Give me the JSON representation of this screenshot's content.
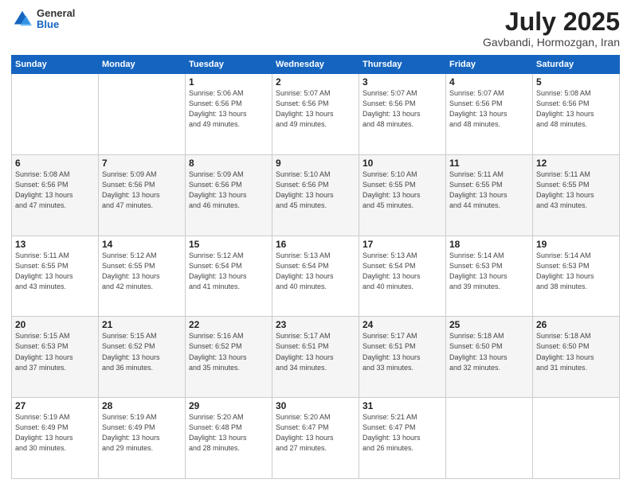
{
  "logo": {
    "general": "General",
    "blue": "Blue"
  },
  "header": {
    "month": "July 2025",
    "location": "Gavbandi, Hormozgan, Iran"
  },
  "weekdays": [
    "Sunday",
    "Monday",
    "Tuesday",
    "Wednesday",
    "Thursday",
    "Friday",
    "Saturday"
  ],
  "rows": [
    [
      {
        "day": "",
        "info": ""
      },
      {
        "day": "",
        "info": ""
      },
      {
        "day": "1",
        "info": "Sunrise: 5:06 AM\nSunset: 6:56 PM\nDaylight: 13 hours\nand 49 minutes."
      },
      {
        "day": "2",
        "info": "Sunrise: 5:07 AM\nSunset: 6:56 PM\nDaylight: 13 hours\nand 49 minutes."
      },
      {
        "day": "3",
        "info": "Sunrise: 5:07 AM\nSunset: 6:56 PM\nDaylight: 13 hours\nand 48 minutes."
      },
      {
        "day": "4",
        "info": "Sunrise: 5:07 AM\nSunset: 6:56 PM\nDaylight: 13 hours\nand 48 minutes."
      },
      {
        "day": "5",
        "info": "Sunrise: 5:08 AM\nSunset: 6:56 PM\nDaylight: 13 hours\nand 48 minutes."
      }
    ],
    [
      {
        "day": "6",
        "info": "Sunrise: 5:08 AM\nSunset: 6:56 PM\nDaylight: 13 hours\nand 47 minutes."
      },
      {
        "day": "7",
        "info": "Sunrise: 5:09 AM\nSunset: 6:56 PM\nDaylight: 13 hours\nand 47 minutes."
      },
      {
        "day": "8",
        "info": "Sunrise: 5:09 AM\nSunset: 6:56 PM\nDaylight: 13 hours\nand 46 minutes."
      },
      {
        "day": "9",
        "info": "Sunrise: 5:10 AM\nSunset: 6:56 PM\nDaylight: 13 hours\nand 45 minutes."
      },
      {
        "day": "10",
        "info": "Sunrise: 5:10 AM\nSunset: 6:55 PM\nDaylight: 13 hours\nand 45 minutes."
      },
      {
        "day": "11",
        "info": "Sunrise: 5:11 AM\nSunset: 6:55 PM\nDaylight: 13 hours\nand 44 minutes."
      },
      {
        "day": "12",
        "info": "Sunrise: 5:11 AM\nSunset: 6:55 PM\nDaylight: 13 hours\nand 43 minutes."
      }
    ],
    [
      {
        "day": "13",
        "info": "Sunrise: 5:11 AM\nSunset: 6:55 PM\nDaylight: 13 hours\nand 43 minutes."
      },
      {
        "day": "14",
        "info": "Sunrise: 5:12 AM\nSunset: 6:55 PM\nDaylight: 13 hours\nand 42 minutes."
      },
      {
        "day": "15",
        "info": "Sunrise: 5:12 AM\nSunset: 6:54 PM\nDaylight: 13 hours\nand 41 minutes."
      },
      {
        "day": "16",
        "info": "Sunrise: 5:13 AM\nSunset: 6:54 PM\nDaylight: 13 hours\nand 40 minutes."
      },
      {
        "day": "17",
        "info": "Sunrise: 5:13 AM\nSunset: 6:54 PM\nDaylight: 13 hours\nand 40 minutes."
      },
      {
        "day": "18",
        "info": "Sunrise: 5:14 AM\nSunset: 6:53 PM\nDaylight: 13 hours\nand 39 minutes."
      },
      {
        "day": "19",
        "info": "Sunrise: 5:14 AM\nSunset: 6:53 PM\nDaylight: 13 hours\nand 38 minutes."
      }
    ],
    [
      {
        "day": "20",
        "info": "Sunrise: 5:15 AM\nSunset: 6:53 PM\nDaylight: 13 hours\nand 37 minutes."
      },
      {
        "day": "21",
        "info": "Sunrise: 5:15 AM\nSunset: 6:52 PM\nDaylight: 13 hours\nand 36 minutes."
      },
      {
        "day": "22",
        "info": "Sunrise: 5:16 AM\nSunset: 6:52 PM\nDaylight: 13 hours\nand 35 minutes."
      },
      {
        "day": "23",
        "info": "Sunrise: 5:17 AM\nSunset: 6:51 PM\nDaylight: 13 hours\nand 34 minutes."
      },
      {
        "day": "24",
        "info": "Sunrise: 5:17 AM\nSunset: 6:51 PM\nDaylight: 13 hours\nand 33 minutes."
      },
      {
        "day": "25",
        "info": "Sunrise: 5:18 AM\nSunset: 6:50 PM\nDaylight: 13 hours\nand 32 minutes."
      },
      {
        "day": "26",
        "info": "Sunrise: 5:18 AM\nSunset: 6:50 PM\nDaylight: 13 hours\nand 31 minutes."
      }
    ],
    [
      {
        "day": "27",
        "info": "Sunrise: 5:19 AM\nSunset: 6:49 PM\nDaylight: 13 hours\nand 30 minutes."
      },
      {
        "day": "28",
        "info": "Sunrise: 5:19 AM\nSunset: 6:49 PM\nDaylight: 13 hours\nand 29 minutes."
      },
      {
        "day": "29",
        "info": "Sunrise: 5:20 AM\nSunset: 6:48 PM\nDaylight: 13 hours\nand 28 minutes."
      },
      {
        "day": "30",
        "info": "Sunrise: 5:20 AM\nSunset: 6:47 PM\nDaylight: 13 hours\nand 27 minutes."
      },
      {
        "day": "31",
        "info": "Sunrise: 5:21 AM\nSunset: 6:47 PM\nDaylight: 13 hours\nand 26 minutes."
      },
      {
        "day": "",
        "info": ""
      },
      {
        "day": "",
        "info": ""
      }
    ]
  ]
}
